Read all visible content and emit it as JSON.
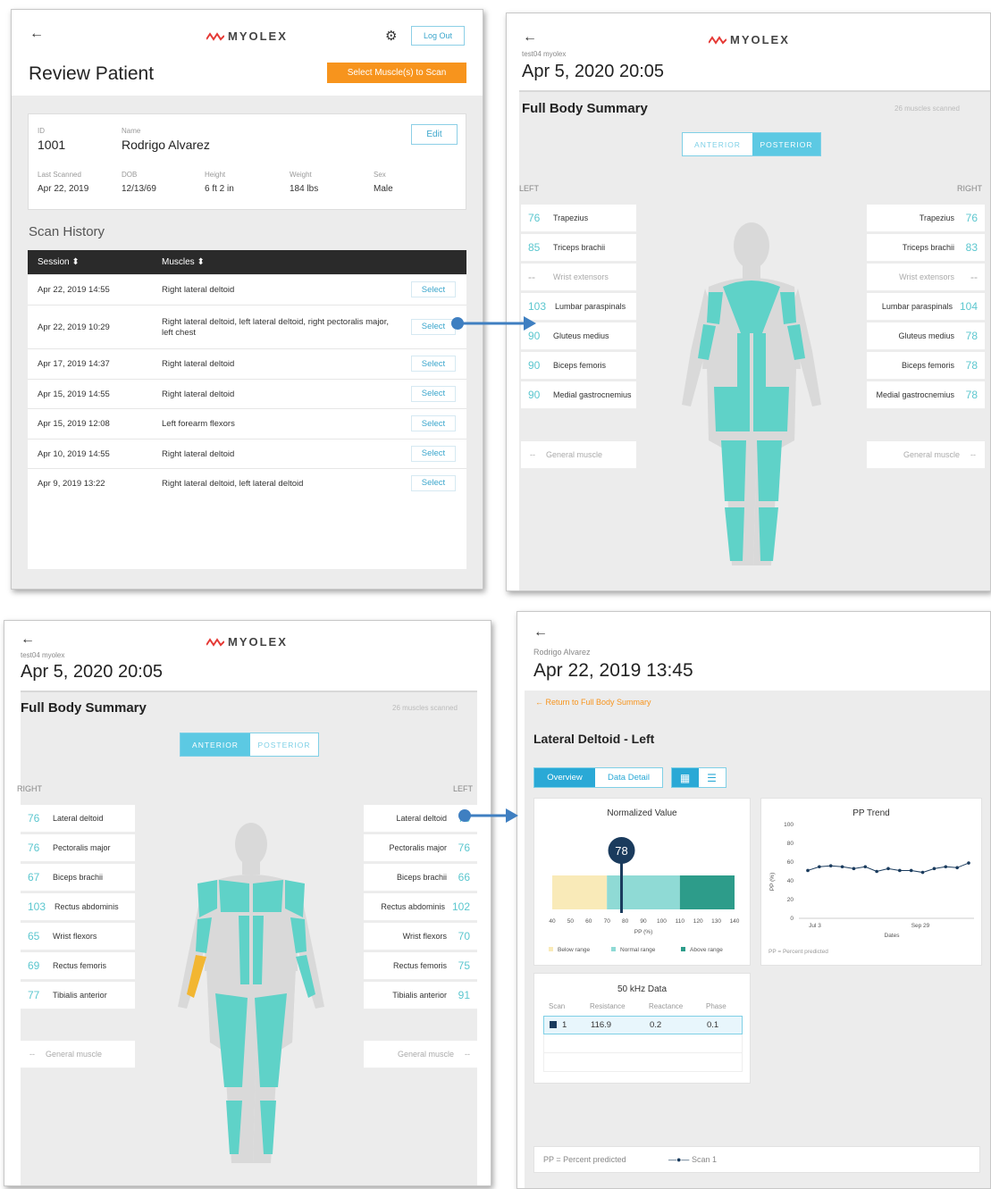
{
  "brand": "MYOLEX",
  "p1": {
    "logout": "Log Out",
    "title": "Review Patient",
    "select_btn": "Select Muscle(s) to Scan",
    "patient": {
      "id_label": "ID",
      "id": "1001",
      "name_label": "Name",
      "name": "Rodrigo Alvarez",
      "edit": "Edit",
      "last_label": "Last Scanned",
      "last": "Apr 22, 2019",
      "dob_label": "DOB",
      "dob": "12/13/69",
      "height_label": "Height",
      "height": "6 ft 2 in",
      "weight_label": "Weight",
      "weight": "184 lbs",
      "sex_label": "Sex",
      "sex": "Male"
    },
    "history_title": "Scan History",
    "col_session": "Session ⬍",
    "col_muscles": "Muscles ⬍",
    "select": "Select",
    "rows": [
      {
        "date": "Apr 22, 2019 14:55",
        "muscles": "Right lateral deltoid"
      },
      {
        "date": "Apr 22, 2019 10:29",
        "muscles": "Right lateral deltoid, left lateral deltoid, right pectoralis major, left chest"
      },
      {
        "date": "Apr 17, 2019 14:37",
        "muscles": "Right lateral deltoid"
      },
      {
        "date": "Apr 15, 2019 14:55",
        "muscles": "Right lateral deltoid"
      },
      {
        "date": "Apr 15, 2019 12:08",
        "muscles": "Left forearm flexors"
      },
      {
        "date": "Apr 10, 2019 14:55",
        "muscles": "Right lateral deltoid"
      },
      {
        "date": "Apr 9, 2019 13:22",
        "muscles": "Right lateral deltoid, left lateral deltoid"
      }
    ]
  },
  "p2": {
    "sub": "test04 myolex",
    "date": "Apr 5, 2020 20:05",
    "summary": "Full Body Summary",
    "scanned": "26 muscles scanned",
    "anterior": "ANTERIOR",
    "posterior": "POSTERIOR",
    "left": "LEFT",
    "right": "RIGHT",
    "left_items": [
      {
        "n": "76",
        "name": "Trapezius"
      },
      {
        "n": "85",
        "name": "Triceps brachii"
      },
      {
        "n": "--",
        "name": "Wrist extensors"
      },
      {
        "n": "103",
        "name": "Lumbar paraspinals"
      },
      {
        "n": "90",
        "name": "Gluteus medius"
      },
      {
        "n": "90",
        "name": "Biceps femoris"
      },
      {
        "n": "90",
        "name": "Medial gastrocnemius"
      }
    ],
    "right_items": [
      {
        "n": "76",
        "name": "Trapezius"
      },
      {
        "n": "83",
        "name": "Triceps brachii"
      },
      {
        "n": "--",
        "name": "Wrist extensors"
      },
      {
        "n": "104",
        "name": "Lumbar paraspinals"
      },
      {
        "n": "78",
        "name": "Gluteus medius"
      },
      {
        "n": "78",
        "name": "Biceps femoris"
      },
      {
        "n": "78",
        "name": "Medial gastrocnemius"
      }
    ],
    "general_n": "--",
    "general": "General muscle"
  },
  "p3": {
    "sub": "test04 myolex",
    "date": "Apr 5, 2020 20:05",
    "summary": "Full Body Summary",
    "scanned": "26 muscles scanned",
    "anterior": "ANTERIOR",
    "posterior": "POSTERIOR",
    "right": "RIGHT",
    "left": "LEFT",
    "right_items": [
      {
        "n": "76",
        "name": "Lateral deltoid"
      },
      {
        "n": "76",
        "name": "Pectoralis major"
      },
      {
        "n": "67",
        "name": "Biceps brachii"
      },
      {
        "n": "103",
        "name": "Rectus abdominis"
      },
      {
        "n": "65",
        "name": "Wrist flexors"
      },
      {
        "n": "69",
        "name": "Rectus femoris"
      },
      {
        "n": "77",
        "name": "Tibialis anterior"
      }
    ],
    "left_items": [
      {
        "n": "78",
        "name": "Lateral deltoid"
      },
      {
        "n": "76",
        "name": "Pectoralis major"
      },
      {
        "n": "66",
        "name": "Biceps brachii"
      },
      {
        "n": "102",
        "name": "Rectus abdominis"
      },
      {
        "n": "70",
        "name": "Wrist flexors"
      },
      {
        "n": "75",
        "name": "Rectus femoris"
      },
      {
        "n": "91",
        "name": "Tibialis anterior"
      }
    ],
    "general_n": "--",
    "general": "General muscle"
  },
  "p4": {
    "name": "Rodrigo Alvarez",
    "date": "Apr 22, 2019 13:45",
    "return": "Return to Full Body Summary",
    "muscle": "Lateral Deltoid - Left",
    "tab_overview": "Overview",
    "tab_detail": "Data Detail",
    "norm_title": "Normalized Value",
    "norm_value": "78",
    "pp_axis": "PP (%)",
    "legend": [
      "Below range",
      "Normal range",
      "Above range"
    ],
    "trend_title": "PP Trend",
    "trend_ylabel": "PP (%)",
    "trend_xlabel": "Dates",
    "trend_xticks": [
      "Jul 3",
      "Sep 29"
    ],
    "pp_note": "PP = Percent predicted",
    "khz_title": "50 kHz Data",
    "khz_cols": [
      "Scan",
      "Resistance",
      "Reactance",
      "Phase"
    ],
    "khz_row": [
      "1",
      "116.9",
      "0.2",
      "0.1"
    ],
    "footer_note": "PP = Percent predicted",
    "footer_legend": "Scan 1"
  },
  "chart_data": [
    {
      "type": "bar",
      "title": "Normalized Value",
      "xlabel": "PP (%)",
      "xticks": [
        40,
        50,
        60,
        70,
        80,
        90,
        100,
        110,
        120,
        130,
        140
      ],
      "ranges": [
        {
          "name": "Below range",
          "from": 40,
          "to": 70
        },
        {
          "name": "Normal range",
          "from": 70,
          "to": 110
        },
        {
          "name": "Above range",
          "from": 110,
          "to": 140
        }
      ],
      "marker": 78
    },
    {
      "type": "line",
      "title": "PP Trend",
      "ylabel": "PP (%)",
      "xlabel": "Dates",
      "ylim": [
        0,
        100
      ],
      "yticks": [
        0,
        20,
        40,
        60,
        80,
        100
      ],
      "xticks": [
        "Jul 3",
        "Sep 29"
      ],
      "series": [
        {
          "name": "Scan 1",
          "values": [
            51,
            55,
            56,
            55,
            53,
            55,
            50,
            53,
            51,
            51,
            49,
            53,
            55,
            54,
            59
          ]
        }
      ]
    }
  ],
  "colors": {
    "accent": "#2aa9d6",
    "orange": "#f7941d",
    "teal": "#5fd2c8",
    "dark_teal": "#2aa88e",
    "below": "#f9eab8",
    "normal": "#8fdad5",
    "above": "#2d9c8a"
  }
}
